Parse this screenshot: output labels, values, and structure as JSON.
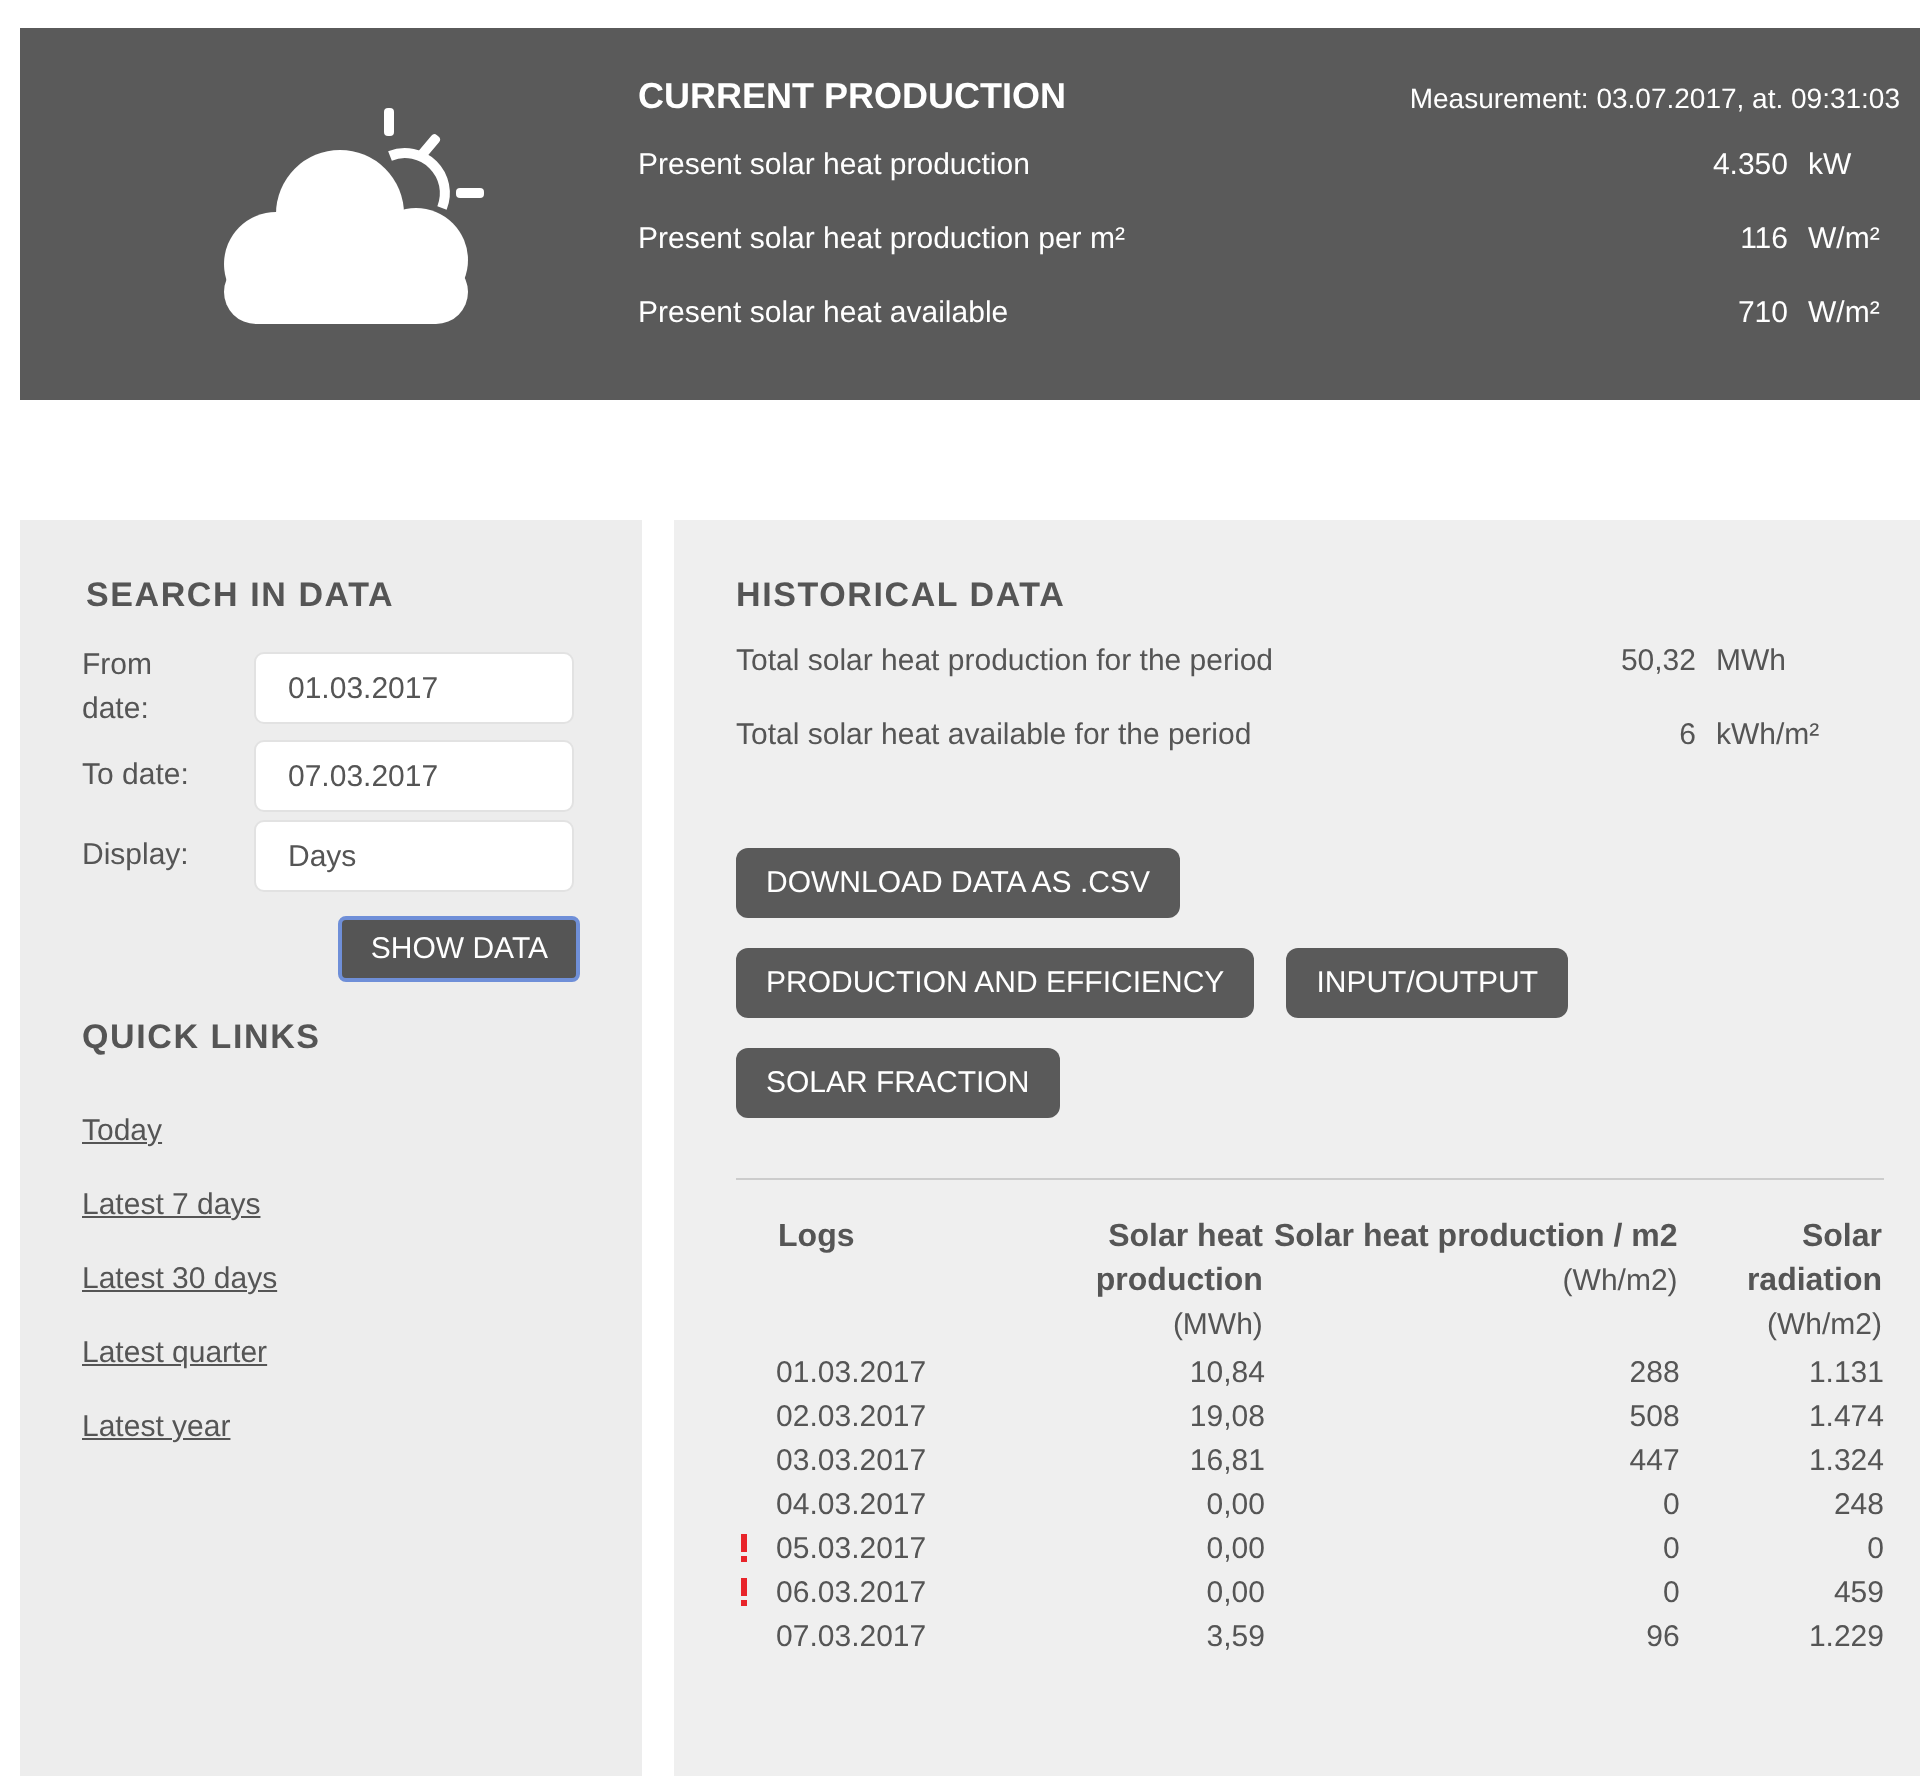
{
  "current_production": {
    "title": "CURRENT PRODUCTION",
    "measurement": "Measurement: 03.07.2017, at. 09:31:03",
    "rows": [
      {
        "label": "Present solar heat production",
        "value": "4.350",
        "unit": "kW"
      },
      {
        "label": "Present solar heat production per m²",
        "value": "116",
        "unit": "W/m²"
      },
      {
        "label": "Present solar heat available",
        "value": "710",
        "unit": "W/m²"
      }
    ]
  },
  "search": {
    "title": "SEARCH IN DATA",
    "fields": [
      {
        "label": "From date:",
        "value": "01.03.2017"
      },
      {
        "label": "To date:",
        "value": "07.03.2017"
      },
      {
        "label": "Display:",
        "value": "Days"
      }
    ],
    "button": "SHOW DATA"
  },
  "quick_links": {
    "title": "QUICK LINKS",
    "links": [
      "Today",
      "Latest 7 days",
      "Latest 30 days",
      "Latest quarter",
      "Latest year"
    ]
  },
  "historical": {
    "title": "HISTORICAL DATA",
    "totals": [
      {
        "label": "Total solar heat production for the period",
        "value": "50,32",
        "unit": "MWh"
      },
      {
        "label": "Total solar heat available for the period",
        "value": "6",
        "unit": "kWh/m²"
      }
    ],
    "buttons": [
      [
        "DOWNLOAD DATA AS .CSV"
      ],
      [
        "PRODUCTION AND EFFICIENCY",
        "INPUT/OUTPUT"
      ],
      [
        "SOLAR FRACTION"
      ]
    ],
    "table": {
      "columns": [
        {
          "title": "Logs"
        },
        {
          "title": "Solar heat production",
          "unit": "(MWh)"
        },
        {
          "title": "Solar heat production / m2",
          "unit": "(Wh/m2)"
        },
        {
          "title": "Solar radiation",
          "unit": "(Wh/m2)"
        }
      ],
      "rows": [
        {
          "warning": false,
          "cells": [
            "01.03.2017",
            "10,84",
            "288",
            "1.131"
          ]
        },
        {
          "warning": false,
          "cells": [
            "02.03.2017",
            "19,08",
            "508",
            "1.474"
          ]
        },
        {
          "warning": false,
          "cells": [
            "03.03.2017",
            "16,81",
            "447",
            "1.324"
          ]
        },
        {
          "warning": false,
          "cells": [
            "04.03.2017",
            "0,00",
            "0",
            "248"
          ]
        },
        {
          "warning": true,
          "cells": [
            "05.03.2017",
            "0,00",
            "0",
            "0"
          ]
        },
        {
          "warning": true,
          "cells": [
            "06.03.2017",
            "0,00",
            "0",
            "459"
          ]
        },
        {
          "warning": false,
          "cells": [
            "07.03.2017",
            "3,59",
            "96",
            "1.229"
          ]
        }
      ]
    }
  }
}
